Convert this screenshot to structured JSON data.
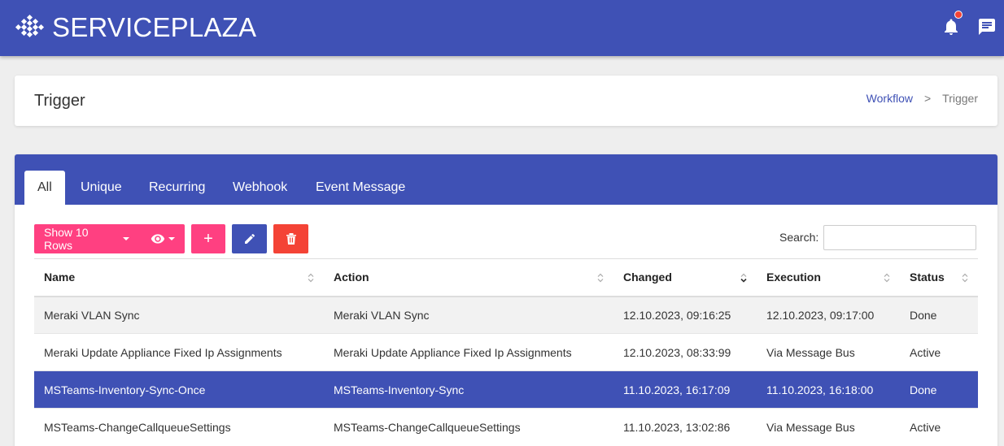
{
  "app": {
    "brand": "SERVICEPLAZA",
    "accent_color": "#3f51b5",
    "pink_color": "#ff4081",
    "danger_color": "#f44336"
  },
  "header_icons": [
    "bell-icon",
    "message-icon"
  ],
  "page": {
    "title": "Trigger",
    "breadcrumb": {
      "parent": "Workflow",
      "separator": ">",
      "current": "Trigger"
    }
  },
  "tabs": [
    "All",
    "Unique",
    "Recurring",
    "Webhook",
    "Event Message"
  ],
  "toolbar": {
    "rows_label": "Show 10 Rows",
    "add_label": "+",
    "search_label": "Search:",
    "search_value": ""
  },
  "table": {
    "columns": [
      "Name",
      "Action",
      "Changed",
      "Execution",
      "Status"
    ],
    "rows": [
      {
        "name": "Meraki VLAN Sync",
        "action": "Meraki VLAN Sync",
        "changed": "12.10.2023, 09:16:25",
        "execution": "12.10.2023, 09:17:00",
        "status": "Done"
      },
      {
        "name": "Meraki Update Appliance Fixed Ip Assignments",
        "action": "Meraki Update Appliance Fixed Ip Assignments",
        "changed": "12.10.2023, 08:33:99",
        "execution": "Via Message Bus",
        "status": "Active"
      },
      {
        "name": "MSTeams-Inventory-Sync-Once",
        "action": "MSTeams-Inventory-Sync",
        "changed": "11.10.2023, 16:17:09",
        "execution": "11.10.2023, 16:18:00",
        "status": "Done"
      },
      {
        "name": "MSTeams-ChangeCallqueueSettings",
        "action": "MSTeams-ChangeCallqueueSettings",
        "changed": "11.10.2023, 13:02:86",
        "execution": "Via Message Bus",
        "status": "Active"
      }
    ]
  }
}
